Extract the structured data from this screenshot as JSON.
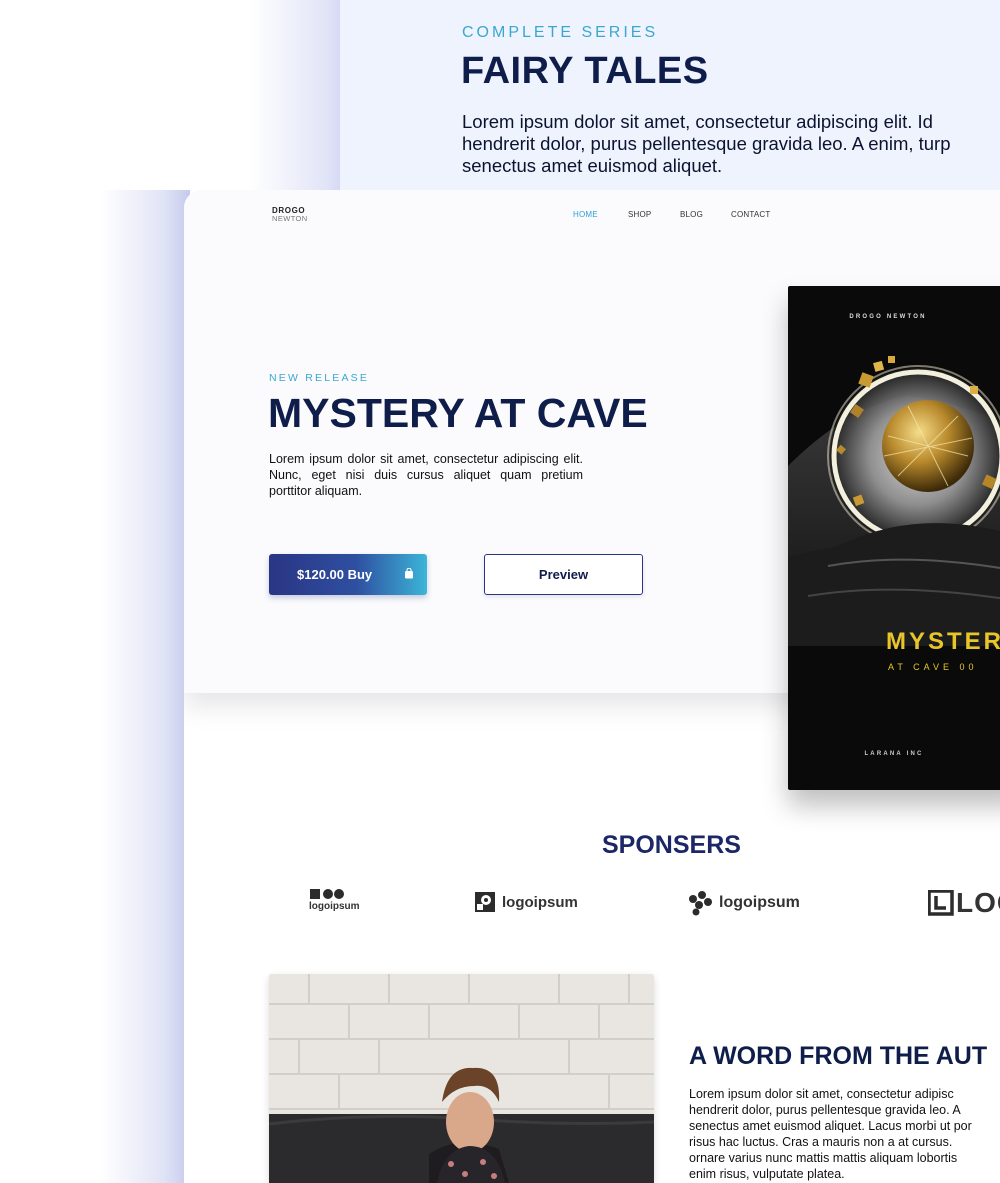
{
  "back_card": {
    "kicker": "COMPLETE SERIES",
    "title": "FAIRY TALES",
    "description_lines": [
      "Lorem ipsum dolor sit amet, consectetur adipiscing elit. Id",
      "hendrerit dolor, purus pellentesque gravida leo. A enim, turp",
      "senectus amet euismod aliquet."
    ]
  },
  "header": {
    "logo_line1": "DROGO",
    "logo_line2": "NEWTON",
    "nav": [
      "HOME",
      "SHOP",
      "BLOG",
      "CONTACT"
    ],
    "active_nav": "HOME"
  },
  "hero": {
    "kicker": "NEW RELEASE",
    "title": "MYSTERY AT CAVE",
    "description": "Lorem ipsum dolor sit amet, consectetur adipiscing elit. Nunc, eget nisi duis cursus aliquet quam pretium porttitor aliquam.",
    "buy_label": "$120.00 Buy",
    "preview_label": "Preview"
  },
  "book": {
    "author": "DROGO NEWTON",
    "title": "MYSTERY",
    "subtitle": "AT CAVE 00",
    "publisher": "LARANA INC"
  },
  "sponsors": {
    "title": "SPONSERS",
    "logos": [
      "logoipsum",
      "logoipsum",
      "logoipsum",
      "LOG"
    ]
  },
  "author_section": {
    "title": "A WORD FROM THE AUT",
    "text_lines": [
      "Lorem ipsum dolor sit amet, consectetur adipisc",
      "hendrerit dolor, purus pellentesque gravida leo. A",
      "senectus amet euismod aliquet. Lacus morbi ut por",
      "risus hac luctus. Cras a mauris non a at cursus.",
      "ornare varius nunc mattis mattis aliquam lobortis",
      "enim risus, vulputate platea."
    ]
  },
  "colors": {
    "accent": "#3aa7d1",
    "navy": "#0f1d4a",
    "buy_gradient_start": "#2a3585",
    "buy_gradient_end": "#3cb5d8",
    "book_title": "#e8c62a"
  }
}
